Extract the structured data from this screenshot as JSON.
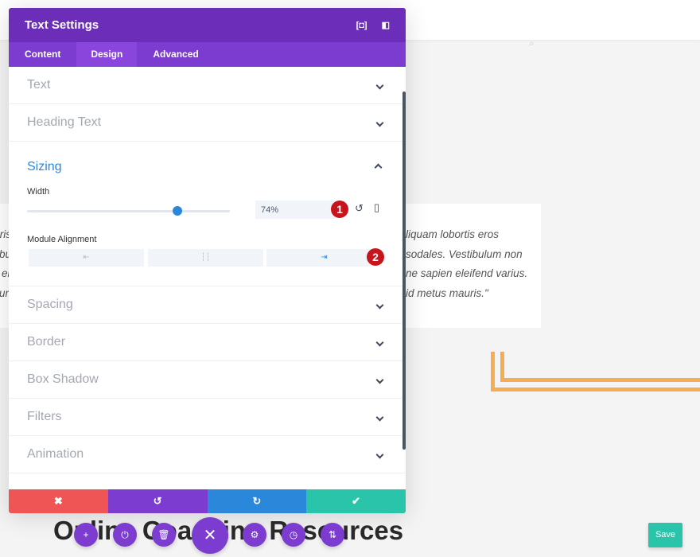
{
  "page": {
    "quote_left": [
      "ris",
      "bu",
      "er",
      "uri"
    ],
    "quote_right": [
      "liquam lobortis eros",
      "sodales. Vestibulum non",
      "ne sapien eleifend varius.",
      "id metus mauris.\""
    ],
    "heading": "Online Coaching Resources",
    "save_label": "Save",
    "accent_orange": "#f5ad55"
  },
  "modal": {
    "title": "Text Settings",
    "header_icons": [
      "fullscreen-icon",
      "sidebar-toggle-icon"
    ],
    "tabs": [
      {
        "label": "Content"
      },
      {
        "label": "Design",
        "active": true
      },
      {
        "label": "Advanced"
      }
    ],
    "sections_before": [
      "Text",
      "Heading Text"
    ],
    "sizing": {
      "title": "Sizing",
      "width_label": "Width",
      "width_value": "74%",
      "width_percent": 74,
      "alignment_label": "Module Alignment",
      "alignment_options": [
        "left",
        "center",
        "right"
      ],
      "alignment_selected": "right",
      "badge1": "1",
      "badge2": "2"
    },
    "sections_after": [
      "Spacing",
      "Border",
      "Box Shadow",
      "Filters",
      "Animation"
    ],
    "footer": {
      "cancel": "✖",
      "undo": "↺",
      "redo": "↻",
      "confirm": "✔"
    },
    "colors": {
      "header": "#6c2eb9",
      "tabs": "#7b3ccf",
      "cancel": "#ef5555",
      "undo": "#7b3ccf",
      "redo": "#2b87da",
      "confirm": "#29c4a9"
    }
  },
  "builder_bar": [
    "add",
    "power",
    "trash",
    "close",
    "settings",
    "history",
    "sort"
  ]
}
